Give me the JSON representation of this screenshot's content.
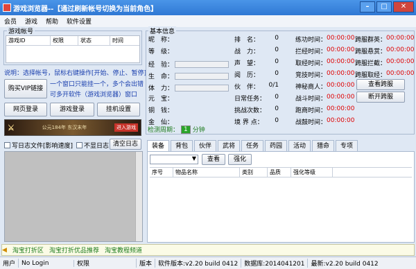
{
  "window": {
    "title": "游戏浏览器--【通过刷新帐号切换为当前角色】"
  },
  "menu": [
    "会员",
    "游戏",
    "帮助",
    "软件设置"
  ],
  "accounts": {
    "legend": "游戏帐号",
    "columns": [
      "游戏ID",
      "权限",
      "状态",
      "时间"
    ],
    "hint": "说明：选择帐号，鼠标右键操作[开始、停止、暂停]",
    "buy_vip": "购买VIP链接",
    "multi_text": "一个窗口只能挂一个，多个会出错",
    "multi_text2": "可多开软件（游戏浏览器）窗口",
    "web_login": "网页登录",
    "game_login": "游戏登录",
    "hang_settings": "挂机设置",
    "banner_text": "公元184年 东汉末年",
    "banner_btn": "进入游戏"
  },
  "log": {
    "write_log": "写日志文件[影响速度]",
    "no_log": "不显日志",
    "clear_log": "清空日志"
  },
  "basic": {
    "legend": "基本信息",
    "col1": [
      "昵　称：",
      "等　级：",
      "经　验：",
      "生　命：",
      "体　力：",
      "元　宝：",
      "铜　钱：",
      "金　仙："
    ],
    "col2": [
      "排　名：",
      "战　力：",
      "声　望：",
      "阅　历：",
      "伙　伴：",
      "日常任务：",
      "挑战次数：",
      "境 界 点："
    ],
    "col2_vals": [
      "0",
      "0",
      "0",
      "0",
      "0/1",
      "0",
      "0",
      "0"
    ],
    "col3": [
      "练功时间：",
      "拦经时间：",
      "取经时间：",
      "竞技时间：",
      "神秘商人：",
      "战斗时间：",
      "跑商时间：",
      "战鼓时间："
    ],
    "col3_vals": [
      "00:00:00",
      "00:00:00",
      "00:00:00",
      "00:00:00",
      "00:00:00",
      "00:00:00",
      "00:00:00",
      "00:00:00"
    ],
    "col4": [
      "跨服群英：",
      "跨服悬赏：",
      "跨服拦截：",
      "跨服取经："
    ],
    "col4_vals": [
      "00:00:00",
      "00:00:00",
      "00:00:00",
      "00:00:00"
    ],
    "view_cross": "查看跨服",
    "disconnect_cross": "断开跨服",
    "check_label": "检测周期：",
    "check_value": "1",
    "check_unit": "分钟"
  },
  "tabs": [
    "装备",
    "背包",
    "伙伴",
    "武将",
    "任务",
    "药园",
    "活动",
    "猎命",
    "专项"
  ],
  "equip": {
    "view": "查看",
    "enhance": "强化",
    "columns": [
      "序号",
      "物品名称",
      "类别",
      "品质",
      "强化等级"
    ]
  },
  "ticker": [
    "淘宝打折区",
    "淘宝打折优品推荐",
    "淘宝教程频道"
  ],
  "status": {
    "user": "用户",
    "login": "No Login",
    "perm": "权限",
    "ver_label": "版本",
    "soft_ver": "软件版本:v2.20 build 0412",
    "db": "数据库:2014041201",
    "latest": "最新:v2.20 build 0412"
  },
  "colors": {
    "accent": "#2f78d4",
    "red": "#e00000",
    "green": "#1c7a1c"
  }
}
